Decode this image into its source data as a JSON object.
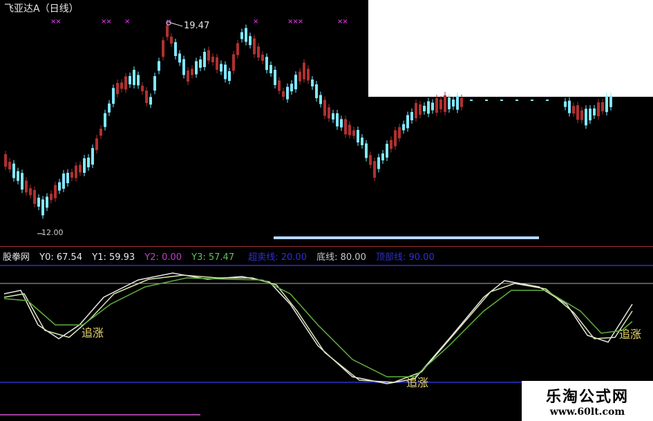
{
  "header": {
    "title": "飞亚达A（日线）",
    "high_price_label": "19.47",
    "low_price_label": "12.00"
  },
  "top_markers": [
    {
      "label": "××"
    },
    {
      "label": "××"
    },
    {
      "label": "×"
    },
    {
      "label": "×"
    },
    {
      "label": "×"
    },
    {
      "label": "×××"
    },
    {
      "label": "××"
    }
  ],
  "indicator": {
    "name": "股拳网",
    "y0_label": "Y0: 67.54",
    "y1_label": "Y1: 59.93",
    "y2_label": "Y2: 0.00",
    "y3_label": "Y3: 57.47",
    "line1_label": "超卖线: 20.00",
    "line2_label": "底线: 80.00",
    "line3_label": "顶部线: 90.00"
  },
  "signals": [
    {
      "label": "追涨"
    },
    {
      "label": "追涨"
    },
    {
      "label": "追涨"
    }
  ],
  "watermark": {
    "name": "乐淘公式网",
    "url": "www.60lt.com"
  },
  "colors": {
    "up_candle": "#b03030",
    "down_candle": "#80e8ff",
    "y0_line": "#e8e8e8",
    "y1_line": "#d8e8b0",
    "y3_line": "#60b040",
    "blue_line": "#3030d0",
    "gray_line": "#b0b0a0",
    "highlight_bar": "#b8d8ff"
  }
}
